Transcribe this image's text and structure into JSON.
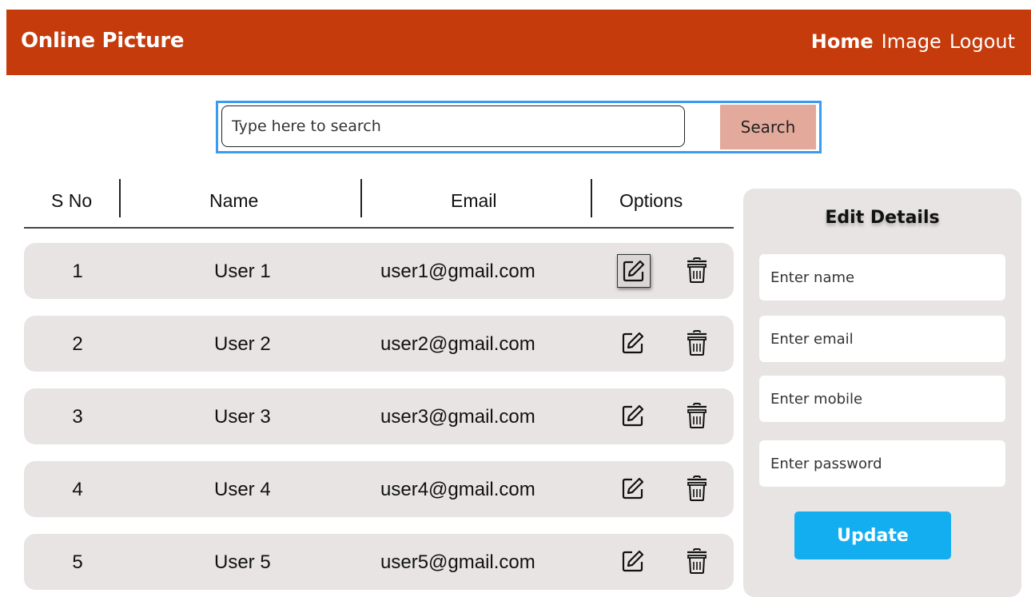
{
  "header": {
    "brand": "Online Picture",
    "nav": [
      {
        "label": "Home",
        "active": true
      },
      {
        "label": "Image",
        "active": false
      },
      {
        "label": "Logout",
        "active": false
      }
    ],
    "color": "#c53b0c"
  },
  "search": {
    "placeholder": "Type here to search",
    "value": "",
    "button_label": "Search"
  },
  "table": {
    "columns": [
      "S No",
      "Name",
      "Email",
      "Options"
    ],
    "rows": [
      {
        "sno": "1",
        "name": "User 1",
        "email": "user1@gmail.com"
      },
      {
        "sno": "2",
        "name": "User 2",
        "email": "user2@gmail.com"
      },
      {
        "sno": "3",
        "name": "User 3",
        "email": "user3@gmail.com"
      },
      {
        "sno": "4",
        "name": "User 4",
        "email": "user4@gmail.com"
      },
      {
        "sno": "5",
        "name": "User 5",
        "email": "user5@gmail.com"
      }
    ],
    "row_icons": [
      "edit-icon",
      "trash-icon"
    ]
  },
  "edit_panel": {
    "title": "Edit Details",
    "fields": [
      {
        "placeholder": "Enter name"
      },
      {
        "placeholder": "Enter email"
      },
      {
        "placeholder": "Enter mobile"
      },
      {
        "placeholder": "Enter password"
      }
    ],
    "button_label": "Update",
    "button_color": "#12aef0"
  }
}
